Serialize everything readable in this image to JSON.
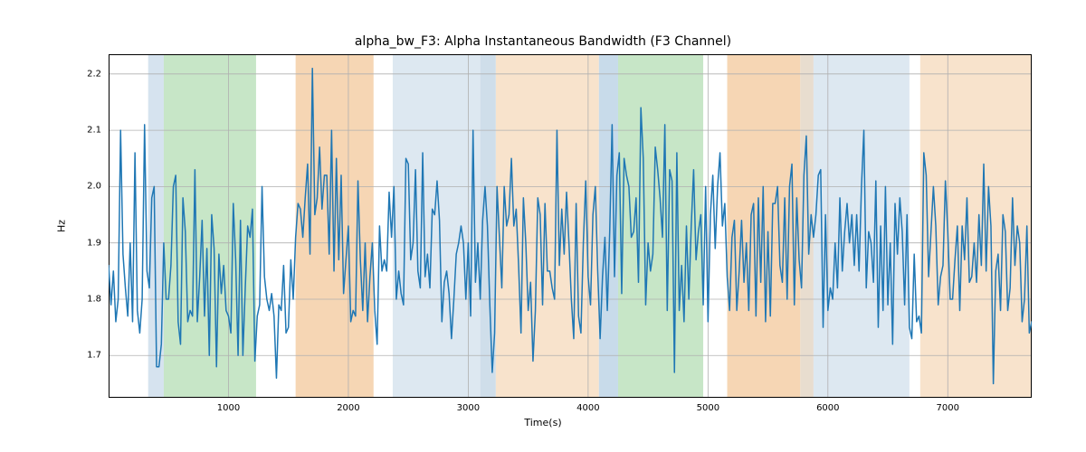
{
  "chart_data": {
    "type": "line",
    "title": "alpha_bw_F3: Alpha Instantaneous Bandwidth (F3 Channel)",
    "xlabel": "Time(s)",
    "ylabel": "Hz",
    "xlim": [
      0,
      7700
    ],
    "ylim": [
      1.625,
      2.235
    ],
    "xticks": [
      1000,
      2000,
      3000,
      4000,
      5000,
      6000,
      7000
    ],
    "yticks": [
      1.7,
      1.8,
      1.9,
      2.0,
      2.1,
      2.2
    ],
    "line_color": "#1f77b4",
    "grid_color": "#b0b0b0",
    "axes_edge": "#000000",
    "background_regions": [
      {
        "x0": 330,
        "x1": 460,
        "fill": "#d6e3ef"
      },
      {
        "x0": 460,
        "x1": 1230,
        "fill": "#c7e6c7"
      },
      {
        "x0": 1560,
        "x1": 2210,
        "fill": "#f6d6b4"
      },
      {
        "x0": 2370,
        "x1": 3100,
        "fill": "#dde8f1"
      },
      {
        "x0": 3100,
        "x1": 3230,
        "fill": "#cfdeea"
      },
      {
        "x0": 3230,
        "x1": 4090,
        "fill": "#f8e3cc"
      },
      {
        "x0": 4090,
        "x1": 4250,
        "fill": "#c8dbea"
      },
      {
        "x0": 4250,
        "x1": 4960,
        "fill": "#c7e6c7"
      },
      {
        "x0": 5160,
        "x1": 5770,
        "fill": "#f6d6b4"
      },
      {
        "x0": 5770,
        "x1": 5880,
        "fill": "#e8ddcf"
      },
      {
        "x0": 5880,
        "x1": 6680,
        "fill": "#dde8f1"
      },
      {
        "x0": 6770,
        "x1": 7700,
        "fill": "#f8e3cc"
      }
    ],
    "x": [
      0,
      20,
      40,
      60,
      80,
      100,
      120,
      140,
      160,
      180,
      200,
      220,
      240,
      260,
      280,
      300,
      320,
      340,
      360,
      380,
      400,
      420,
      440,
      460,
      480,
      500,
      520,
      540,
      560,
      580,
      600,
      620,
      640,
      660,
      680,
      700,
      720,
      740,
      760,
      780,
      800,
      820,
      840,
      860,
      880,
      900,
      920,
      940,
      960,
      980,
      1000,
      1020,
      1040,
      1060,
      1080,
      1100,
      1120,
      1140,
      1160,
      1180,
      1200,
      1220,
      1240,
      1260,
      1280,
      1300,
      1320,
      1340,
      1360,
      1380,
      1400,
      1420,
      1440,
      1460,
      1480,
      1500,
      1520,
      1540,
      1560,
      1580,
      1600,
      1620,
      1640,
      1660,
      1680,
      1700,
      1720,
      1740,
      1760,
      1780,
      1800,
      1820,
      1840,
      1860,
      1880,
      1900,
      1920,
      1940,
      1960,
      1980,
      2000,
      2020,
      2040,
      2060,
      2080,
      2100,
      2120,
      2140,
      2160,
      2180,
      2200,
      2220,
      2240,
      2260,
      2280,
      2300,
      2320,
      2340,
      2360,
      2380,
      2400,
      2420,
      2440,
      2460,
      2480,
      2500,
      2520,
      2540,
      2560,
      2580,
      2600,
      2620,
      2640,
      2660,
      2680,
      2700,
      2720,
      2740,
      2760,
      2780,
      2800,
      2820,
      2840,
      2860,
      2880,
      2900,
      2920,
      2940,
      2960,
      2980,
      3000,
      3020,
      3040,
      3060,
      3080,
      3100,
      3120,
      3140,
      3160,
      3180,
      3200,
      3220,
      3240,
      3260,
      3280,
      3300,
      3320,
      3340,
      3360,
      3380,
      3400,
      3420,
      3440,
      3460,
      3480,
      3500,
      3520,
      3540,
      3560,
      3580,
      3600,
      3620,
      3640,
      3660,
      3680,
      3700,
      3720,
      3740,
      3760,
      3780,
      3800,
      3820,
      3840,
      3860,
      3880,
      3900,
      3920,
      3940,
      3960,
      3980,
      4000,
      4020,
      4040,
      4060,
      4080,
      4100,
      4120,
      4140,
      4160,
      4180,
      4200,
      4220,
      4240,
      4260,
      4280,
      4300,
      4320,
      4340,
      4360,
      4380,
      4400,
      4420,
      4440,
      4460,
      4480,
      4500,
      4520,
      4540,
      4560,
      4580,
      4600,
      4620,
      4640,
      4660,
      4680,
      4700,
      4720,
      4740,
      4760,
      4780,
      4800,
      4820,
      4840,
      4860,
      4880,
      4900,
      4920,
      4940,
      4960,
      4980,
      5000,
      5020,
      5040,
      5060,
      5080,
      5100,
      5120,
      5140,
      5160,
      5180,
      5200,
      5220,
      5240,
      5260,
      5280,
      5300,
      5320,
      5340,
      5360,
      5380,
      5400,
      5420,
      5440,
      5460,
      5480,
      5500,
      5520,
      5540,
      5560,
      5580,
      5600,
      5620,
      5640,
      5660,
      5680,
      5700,
      5720,
      5740,
      5760,
      5780,
      5800,
      5820,
      5840,
      5860,
      5880,
      5900,
      5920,
      5940,
      5960,
      5980,
      6000,
      6020,
      6040,
      6060,
      6080,
      6100,
      6120,
      6140,
      6160,
      6180,
      6200,
      6220,
      6240,
      6260,
      6280,
      6300,
      6320,
      6340,
      6360,
      6380,
      6400,
      6420,
      6440,
      6460,
      6480,
      6500,
      6520,
      6540,
      6560,
      6580,
      6600,
      6620,
      6640,
      6660,
      6680,
      6700,
      6720,
      6740,
      6760,
      6780,
      6800,
      6820,
      6840,
      6860,
      6880,
      6900,
      6920,
      6940,
      6960,
      6980,
      7000,
      7020,
      7040,
      7060,
      7080,
      7100,
      7120,
      7140,
      7160,
      7180,
      7200,
      7220,
      7240,
      7260,
      7280,
      7300,
      7320,
      7340,
      7360,
      7380,
      7400,
      7420,
      7440,
      7460,
      7480,
      7500,
      7520,
      7540,
      7560,
      7580,
      7600,
      7620,
      7640,
      7660,
      7680,
      7700
    ],
    "values": [
      1.86,
      1.79,
      1.85,
      1.76,
      1.8,
      2.1,
      1.88,
      1.82,
      1.77,
      1.9,
      1.76,
      2.06,
      1.78,
      1.74,
      1.8,
      2.11,
      1.85,
      1.82,
      1.98,
      2.0,
      1.68,
      1.68,
      1.72,
      1.9,
      1.8,
      1.8,
      1.86,
      2.0,
      2.02,
      1.76,
      1.72,
      1.98,
      1.92,
      1.76,
      1.78,
      1.77,
      2.03,
      1.76,
      1.84,
      1.94,
      1.77,
      1.89,
      1.7,
      1.95,
      1.89,
      1.68,
      1.88,
      1.81,
      1.86,
      1.78,
      1.77,
      1.74,
      1.97,
      1.87,
      1.7,
      1.94,
      1.7,
      1.82,
      1.93,
      1.91,
      1.96,
      1.69,
      1.77,
      1.79,
      2.0,
      1.84,
      1.8,
      1.78,
      1.81,
      1.77,
      1.66,
      1.79,
      1.78,
      1.86,
      1.74,
      1.75,
      1.87,
      1.8,
      1.91,
      1.97,
      1.96,
      1.91,
      1.98,
      2.04,
      1.88,
      2.21,
      1.95,
      1.98,
      2.07,
      1.96,
      2.02,
      2.02,
      1.88,
      2.1,
      1.85,
      2.05,
      1.87,
      2.02,
      1.81,
      1.87,
      1.93,
      1.76,
      1.78,
      1.77,
      2.01,
      1.87,
      1.78,
      1.9,
      1.76,
      1.84,
      1.9,
      1.78,
      1.72,
      1.93,
      1.85,
      1.87,
      1.85,
      1.99,
      1.91,
      2.0,
      1.8,
      1.85,
      1.81,
      1.79,
      2.05,
      2.04,
      1.87,
      1.9,
      2.03,
      1.85,
      1.82,
      2.06,
      1.84,
      1.88,
      1.82,
      1.96,
      1.95,
      2.01,
      1.94,
      1.76,
      1.83,
      1.85,
      1.81,
      1.73,
      1.8,
      1.88,
      1.9,
      1.93,
      1.9,
      1.8,
      1.9,
      1.77,
      2.1,
      1.83,
      1.9,
      1.8,
      1.94,
      2.0,
      1.93,
      1.79,
      1.67,
      1.74,
      2.0,
      1.91,
      1.82,
      2.0,
      1.93,
      1.95,
      2.05,
      1.93,
      1.96,
      1.86,
      1.74,
      1.98,
      1.9,
      1.78,
      1.83,
      1.69,
      1.78,
      1.98,
      1.95,
      1.79,
      1.97,
      1.85,
      1.85,
      1.82,
      1.8,
      2.1,
      1.86,
      1.96,
      1.88,
      1.99,
      1.9,
      1.8,
      1.73,
      1.97,
      1.77,
      1.74,
      1.9,
      2.01,
      1.84,
      1.79,
      1.95,
      2.0,
      1.85,
      1.73,
      1.84,
      1.91,
      1.78,
      1.92,
      2.11,
      1.84,
      2.02,
      2.06,
      1.81,
      2.05,
      2.02,
      2.0,
      1.91,
      1.92,
      1.98,
      1.83,
      2.14,
      2.05,
      1.79,
      1.9,
      1.85,
      1.88,
      2.07,
      2.03,
      1.98,
      1.91,
      2.11,
      1.78,
      2.03,
      2.01,
      1.67,
      2.06,
      1.78,
      1.86,
      1.76,
      1.93,
      1.8,
      1.93,
      2.03,
      1.87,
      1.92,
      1.95,
      1.79,
      2.0,
      1.76,
      1.95,
      2.02,
      1.89,
      2.0,
      2.06,
      1.93,
      1.97,
      1.84,
      1.78,
      1.91,
      1.94,
      1.78,
      1.85,
      1.94,
      1.83,
      1.9,
      1.78,
      1.95,
      1.97,
      1.77,
      1.98,
      1.83,
      2.0,
      1.76,
      1.92,
      1.77,
      1.97,
      1.97,
      2.0,
      1.86,
      1.83,
      1.98,
      1.8,
      2.0,
      2.04,
      1.79,
      1.98,
      1.87,
      1.82,
      2.02,
      2.09,
      1.88,
      1.95,
      1.91,
      1.95,
      2.02,
      2.03,
      1.75,
      1.95,
      1.78,
      1.82,
      1.8,
      1.9,
      1.82,
      1.98,
      1.85,
      1.92,
      1.97,
      1.9,
      1.95,
      1.86,
      1.95,
      1.85,
      2.0,
      2.1,
      1.82,
      1.92,
      1.9,
      1.83,
      2.01,
      1.75,
      1.93,
      1.78,
      2.0,
      1.79,
      1.9,
      1.72,
      1.97,
      1.88,
      1.98,
      1.92,
      1.79,
      1.95,
      1.75,
      1.73,
      1.88,
      1.76,
      1.77,
      1.74,
      2.06,
      2.02,
      1.84,
      1.92,
      2.0,
      1.93,
      1.79,
      1.84,
      1.86,
      2.01,
      1.92,
      1.8,
      1.8,
      1.87,
      1.93,
      1.78,
      1.93,
      1.87,
      1.98,
      1.83,
      1.84,
      1.9,
      1.83,
      1.95,
      1.86,
      2.04,
      1.85,
      2.0,
      1.93,
      1.65,
      1.85,
      1.88,
      1.78,
      1.95,
      1.92,
      1.78,
      1.82,
      1.98,
      1.86,
      1.93,
      1.9,
      1.76,
      1.8,
      1.93,
      1.74,
      1.76
    ]
  }
}
